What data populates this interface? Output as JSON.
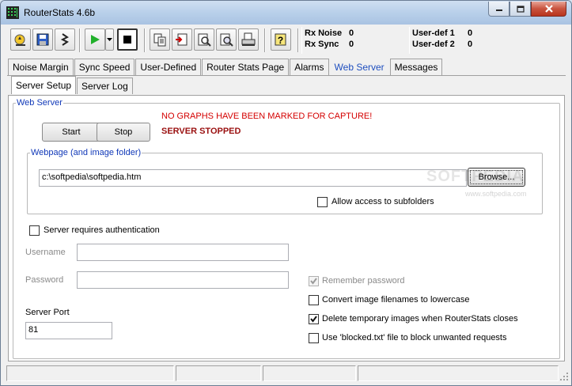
{
  "window": {
    "title": "RouterStats 4.6b",
    "minimize_icon": "minimize-icon",
    "maximize_icon": "maximize-icon",
    "close_icon": "close-icon"
  },
  "toolbar": {
    "buttons": [
      {
        "icon": "connect-icon"
      },
      {
        "icon": "save-icon"
      },
      {
        "icon": "settings-icon"
      },
      {
        "icon": "play-icon"
      },
      {
        "icon": "dropdown-arrow-icon"
      },
      {
        "icon": "stop-icon"
      },
      {
        "icon": "copy-icon"
      },
      {
        "icon": "export-icon"
      },
      {
        "icon": "zoom-graph-icon"
      },
      {
        "icon": "zoom-all-icon"
      },
      {
        "icon": "print-icon"
      },
      {
        "icon": "help-icon"
      }
    ],
    "stats": {
      "rx_noise_label": "Rx Noise",
      "rx_noise_value": "0",
      "rx_sync_label": "Rx Sync",
      "rx_sync_value": "0",
      "userdef1_label": "User-def 1",
      "userdef1_value": "0",
      "userdef2_label": "User-def 2",
      "userdef2_value": "0"
    }
  },
  "tabs": [
    "Noise Margin",
    "Sync Speed",
    "User-Defined",
    "Router Stats Page",
    "Alarms",
    "Web Server",
    "Messages"
  ],
  "active_tab": "Web Server",
  "subtabs": [
    "Server Setup",
    "Server Log"
  ],
  "active_subtab": "Server Setup",
  "web_server": {
    "legend": "Web Server",
    "start_label": "Start",
    "stop_label": "Stop",
    "warning": "NO GRAPHS HAVE BEEN MARKED FOR CAPTURE!",
    "status": "SERVER STOPPED"
  },
  "webpage": {
    "legend": "Webpage (and image folder)",
    "path_value": "c:\\softpedia\\softpedia.htm",
    "browse_label": "Browse...",
    "allow_subfolders_label": "Allow access to subfolders",
    "allow_subfolders_checked": false
  },
  "auth": {
    "requires_auth_label": "Server requires authentication",
    "requires_auth_checked": false,
    "username_label": "Username",
    "username_value": "",
    "password_label": "Password",
    "password_value": "",
    "remember_password_label": "Remember password",
    "remember_password_checked": true
  },
  "port": {
    "label": "Server Port",
    "value": "81"
  },
  "options": [
    {
      "label": "Convert image filenames to lowercase",
      "checked": false
    },
    {
      "label": "Delete temporary images when RouterStats closes",
      "checked": true
    },
    {
      "label": "Use 'blocked.txt' file to block unwanted requests",
      "checked": false
    }
  ],
  "watermark": {
    "text": "SOFTPEDIA",
    "url": "www.softpedia.com"
  },
  "colors": {
    "accent": "#1038b8",
    "warning": "#d40000",
    "status": "#9a1010"
  }
}
